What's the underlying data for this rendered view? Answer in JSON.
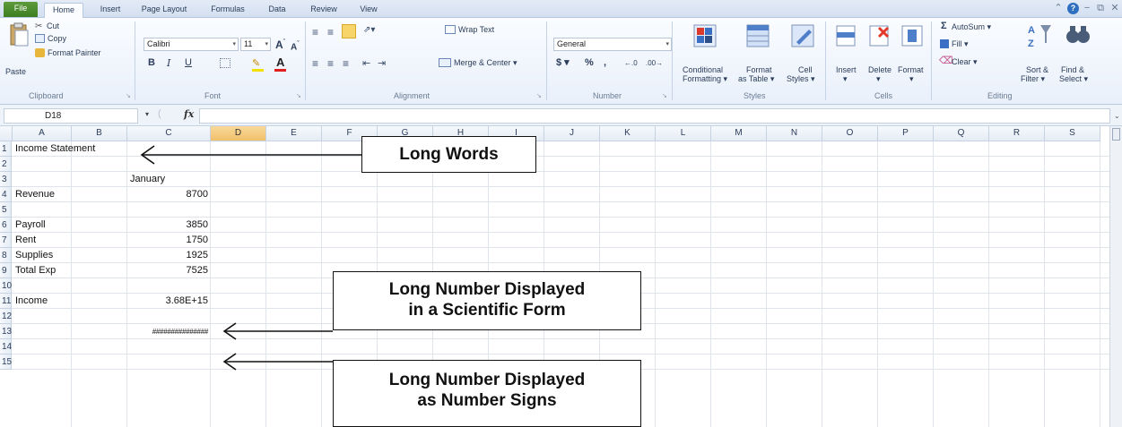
{
  "tabs": [
    "File",
    "Home",
    "Insert",
    "Page Layout",
    "Formulas",
    "Data",
    "Review",
    "View"
  ],
  "active_tab": "Home",
  "accent_file": "#4a8a2c",
  "clipboard": {
    "paste": "Paste",
    "cut": "Cut",
    "copy": "Copy",
    "format_painter": "Format Painter",
    "label": "Clipboard"
  },
  "font": {
    "name": "Calibri",
    "size": "11",
    "bold": "B",
    "italic": "I",
    "underline": "U",
    "label": "Font"
  },
  "alignment": {
    "wrap_text": "Wrap Text",
    "merge_center": "Merge & Center",
    "label": "Alignment"
  },
  "number": {
    "format": "General",
    "currency": "$",
    "percent": "%",
    "comma": ",",
    "label": "Number"
  },
  "styles": {
    "conditional": "Conditional",
    "conditional2": "Formatting",
    "format_table": "Format",
    "format_table2": "as Table",
    "cell_styles": "Cell",
    "cell_styles2": "Styles",
    "label": "Styles"
  },
  "cells_group": {
    "insert": "Insert",
    "delete": "Delete",
    "format": "Format",
    "label": "Cells"
  },
  "editing": {
    "autosum": "AutoSum",
    "fill": "Fill",
    "clear": "Clear",
    "sort": "Sort &",
    "sort2": "Filter",
    "find": "Find &",
    "find2": "Select",
    "label": "Editing"
  },
  "formula_bar": {
    "name_box": "D18",
    "fx": "fx",
    "value": ""
  },
  "columns": [
    "A",
    "B",
    "C",
    "D",
    "E",
    "F",
    "G",
    "H",
    "I",
    "J",
    "K",
    "L",
    "M",
    "N",
    "O",
    "P",
    "Q",
    "R",
    "S"
  ],
  "selected_column": "D",
  "rows": [
    "1",
    "2",
    "3",
    "4",
    "5",
    "6",
    "7",
    "8",
    "9",
    "10",
    "11",
    "12",
    "13",
    "14",
    "15"
  ],
  "cells": {
    "A1": "Income Statement",
    "C3": "January",
    "A4": "Revenue",
    "C4": "8700",
    "A6": "Payroll",
    "C6": "3850",
    "A7": "Rent",
    "C7": "1750",
    "A8": "Supplies",
    "C8": "1925",
    "A9": "Total Exp",
    "C9": "7525",
    "A11": "Income",
    "C11": "3.68E+15",
    "C13": "###############"
  },
  "callouts": {
    "long_words": "Long Words",
    "scientific_1": "Long Number Displayed",
    "scientific_2": "in a Scientific Form",
    "signs_1": "Long Number Displayed",
    "signs_2": "as Number Signs"
  }
}
